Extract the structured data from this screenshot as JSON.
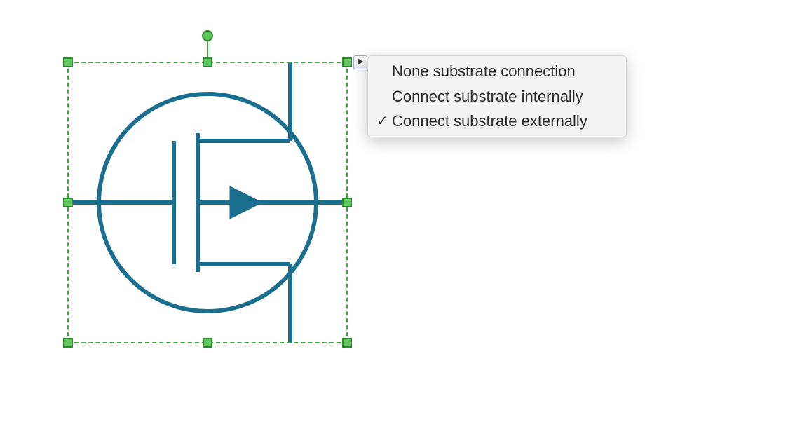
{
  "menu": {
    "items": [
      {
        "label": "None substrate connection",
        "checked": false
      },
      {
        "label": "Connect substrate internally",
        "checked": false
      },
      {
        "label": "Connect substrate externally",
        "checked": true
      }
    ]
  },
  "symbol": {
    "stroke": "#1a6e8e",
    "fill": "#1a6e8e"
  },
  "selection": {
    "handle_color": "#5ec75e",
    "border_color": "#3ea63e"
  }
}
